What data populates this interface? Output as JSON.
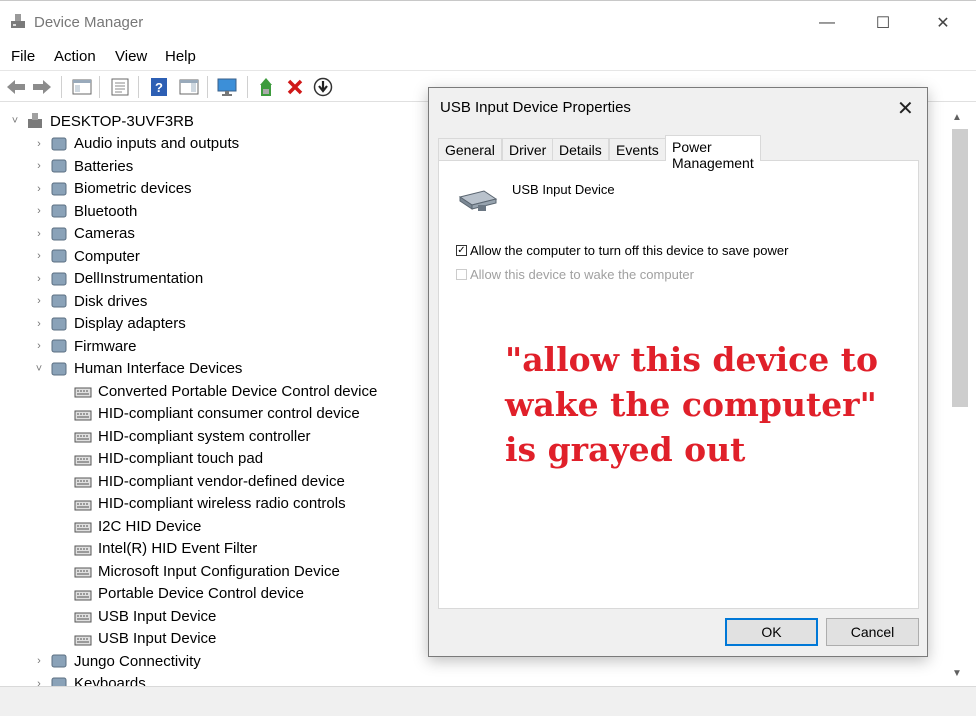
{
  "window": {
    "title": "Device Manager",
    "controls": {
      "minimize": "—",
      "maximize": "☐",
      "close": "✕"
    }
  },
  "menu": [
    "File",
    "Action",
    "View",
    "Help"
  ],
  "toolbar_icons": [
    "back-icon",
    "forward-icon",
    "show-hide-console-tree-icon",
    "properties-icon",
    "help-icon",
    "action-pane-icon",
    "scan-hardware-icon",
    "update-driver-icon",
    "uninstall-icon",
    "disable-device-icon"
  ],
  "tree": {
    "root": "DESKTOP-3UVF3RB",
    "categories": [
      "Audio inputs and outputs",
      "Batteries",
      "Biometric devices",
      "Bluetooth",
      "Cameras",
      "Computer",
      "DellInstrumentation",
      "Disk drives",
      "Display adapters",
      "Firmware",
      "Human Interface Devices"
    ],
    "hid_children": [
      "Converted Portable Device Control device",
      "HID-compliant consumer control device",
      "HID-compliant system controller",
      "HID-compliant touch pad",
      "HID-compliant vendor-defined device",
      "HID-compliant wireless radio controls",
      "I2C HID Device",
      "Intel(R) HID Event Filter",
      "Microsoft Input Configuration Device",
      "Portable Device Control device",
      "USB Input Device",
      "USB Input Device"
    ],
    "after": [
      "Jungo Connectivity",
      "Keyboards"
    ]
  },
  "dialog": {
    "title": "USB Input Device Properties",
    "close": "✕",
    "tabs": [
      "General",
      "Driver",
      "Details",
      "Events",
      "Power Management"
    ],
    "active_tab": "Power Management",
    "device_name": "USB Input Device",
    "option1": {
      "label": "Allow the computer to turn off this device to save power",
      "checked": true
    },
    "option2": {
      "label": "Allow this device to wake the computer",
      "checked": false,
      "disabled": true
    },
    "annotation": [
      "\"allow this device to",
      "wake the computer\"",
      "is grayed out"
    ],
    "ok": "OK",
    "cancel": "Cancel"
  },
  "colors": {
    "annotation": "#e0202a",
    "default_button": "#0078d7"
  }
}
